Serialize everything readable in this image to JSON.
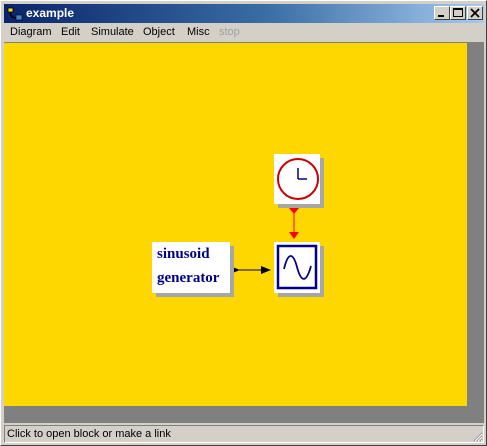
{
  "window": {
    "title": "example",
    "icon": "scilab-xcos-app-icon",
    "controls": [
      "minimize-icon",
      "maximize-icon",
      "close-icon"
    ]
  },
  "menu": {
    "items": [
      {
        "label": "Diagram",
        "enabled": true
      },
      {
        "label": "Edit",
        "enabled": true
      },
      {
        "label": "Simulate",
        "enabled": true
      },
      {
        "label": "Object",
        "enabled": true
      },
      {
        "label": "Misc",
        "enabled": true
      },
      {
        "label": "stop",
        "enabled": false
      }
    ]
  },
  "diagram": {
    "background": "#ffd700",
    "blocks": [
      {
        "id": "clock",
        "icon": "clock-icon"
      },
      {
        "id": "sinusoid",
        "line1": "sinusoid",
        "line2": "generator"
      },
      {
        "id": "scope",
        "icon": "sine-wave-scope-icon"
      }
    ],
    "links": [
      {
        "from": "clock",
        "to": "scope",
        "type": "activation",
        "color": "#ff0000"
      },
      {
        "from": "sinusoid",
        "to": "scope",
        "type": "regular",
        "color": "#000000"
      }
    ]
  },
  "status": {
    "text": "Click to open block or make a link"
  }
}
